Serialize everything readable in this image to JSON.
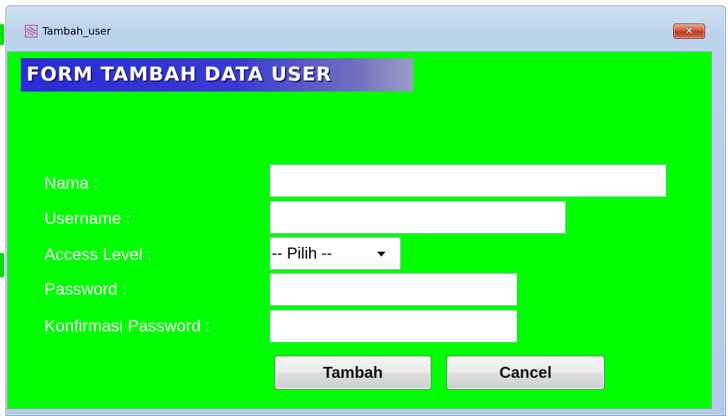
{
  "window": {
    "title": "Tambah_user",
    "close_label": "✕"
  },
  "form": {
    "heading": "FORM TAMBAH DATA USER",
    "fields": {
      "nama": {
        "label": "Nama :",
        "value": ""
      },
      "username": {
        "label": "Username :",
        "value": ""
      },
      "access_level": {
        "label": "Access Level :",
        "selected": "-- Pilih --"
      },
      "password": {
        "label": "Password :",
        "value": ""
      },
      "konfirmasi": {
        "label": "Konfirmasi Password :",
        "value": ""
      }
    },
    "buttons": {
      "tambah": "Tambah",
      "cancel": "Cancel"
    }
  },
  "colors": {
    "client_background": "#00ff00",
    "banner": "#2b2bd9",
    "label_text": "#ffffff"
  },
  "icons": {
    "app": "window-app-icon",
    "close": "close-icon",
    "dropdown": "chevron-down-icon"
  }
}
